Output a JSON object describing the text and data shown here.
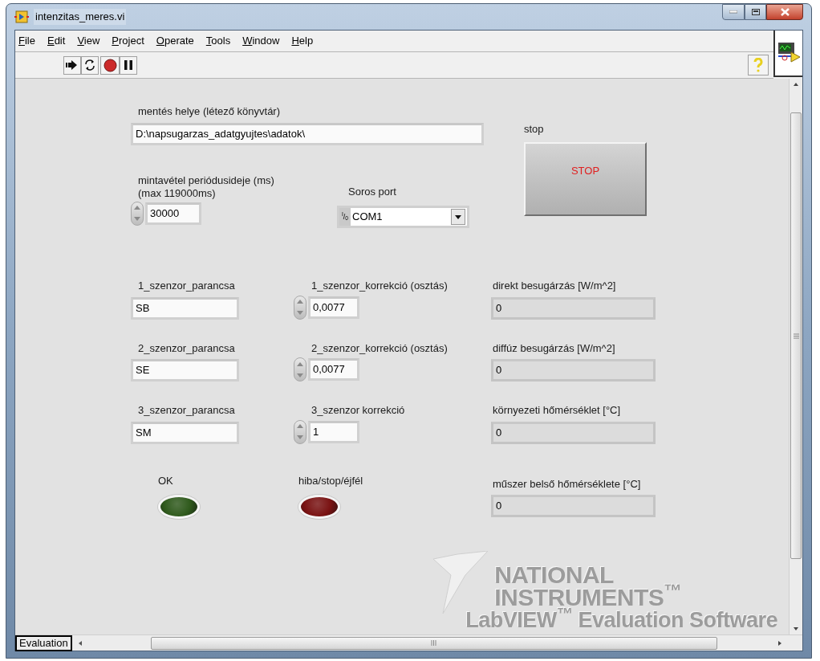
{
  "window": {
    "title": "intenzitas_meres.vi"
  },
  "menu": [
    "File",
    "Edit",
    "View",
    "Project",
    "Operate",
    "Tools",
    "Window",
    "Help"
  ],
  "panel": {
    "path_control": {
      "label": "mentés helye (létező könyvtár)",
      "value": "D:\\napsugarzas_adatgyujtes\\adatok\\"
    },
    "stop_button": {
      "label": "stop",
      "text": "STOP"
    },
    "period_control": {
      "label": [
        "mintavétel periódusideje (ms)",
        "(max 119000ms)"
      ],
      "value": "30000"
    },
    "serial_port": {
      "label": "Soros port",
      "io_label": "$^{I}$/$_{0}$",
      "value": "COM1"
    },
    "rows": [
      {
        "command": {
          "label": "1_szenzor_parancsa",
          "value": "SB"
        },
        "correction": {
          "label": "1_szenzor_korrekció (osztás)",
          "value": "0,0077"
        },
        "indicator": {
          "label": "direkt besugárzás [W/m^2]",
          "value": "0"
        }
      },
      {
        "command": {
          "label": "2_szenzor_parancsa",
          "value": "SE"
        },
        "correction": {
          "label": "2_szenzor_korrekció (osztás)",
          "value": "0,0077"
        },
        "indicator": {
          "label": "diffúz besugárzás [W/m^2]",
          "value": "0"
        }
      },
      {
        "command": {
          "label": "3_szenzor_parancsa",
          "value": "SM"
        },
        "correction": {
          "label": "3_szenzor korrekció",
          "value": "1"
        },
        "indicator": {
          "label": "környezeti hőmérséklet [°C]",
          "value": "0"
        }
      }
    ],
    "leds": [
      {
        "label": "OK",
        "on": false,
        "color": "#2f5a1c"
      },
      {
        "label": "hiba/stop/éjfél",
        "on": false,
        "color": "#7a1212"
      }
    ],
    "instrument_temp": {
      "label": "műszer belső hőmérséklete [°C]",
      "value": "0"
    },
    "watermark": [
      "NATIONAL",
      "INSTRUMENTS$^{™}$",
      "LabVIEW$^{™}$ Evaluation Software"
    ]
  },
  "bottom_bar": {
    "tab": "Evaluation"
  }
}
